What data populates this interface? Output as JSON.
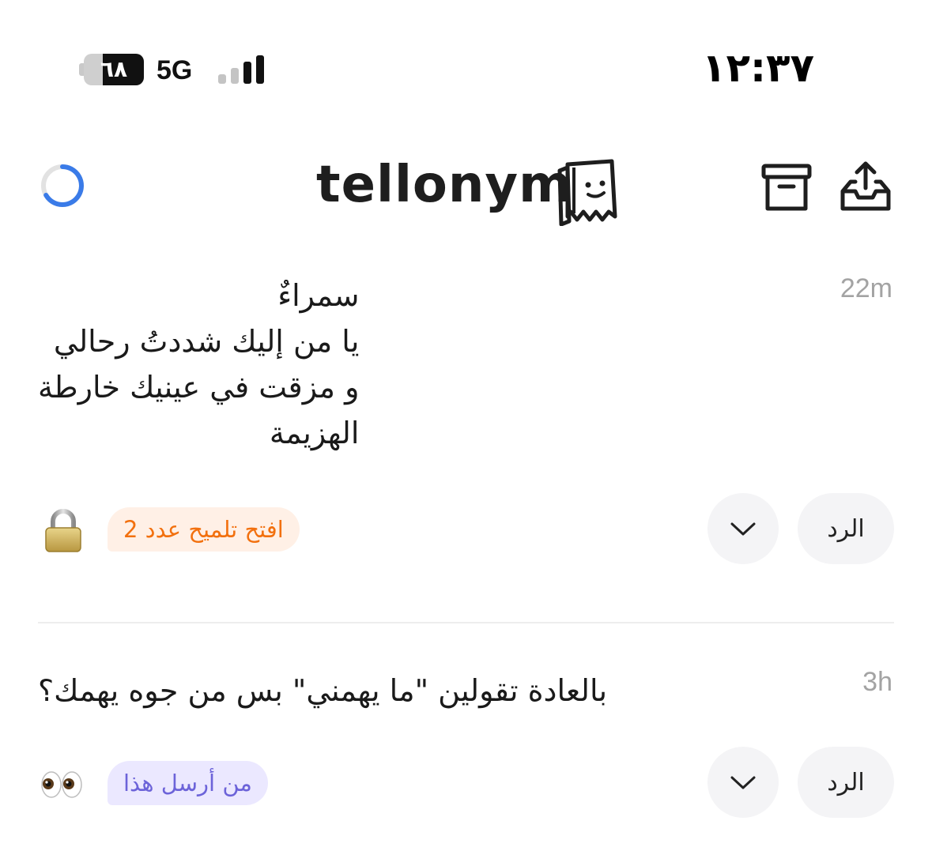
{
  "status_bar": {
    "time": "١٢:٣٧",
    "network": "5G",
    "battery_level": "٦٨",
    "battery_fraction": 0.68,
    "signal_bars": 2,
    "signal_total": 4
  },
  "header": {
    "logo": "tellonym",
    "icons": {
      "left": "loading-ring",
      "archive": "archive-box-icon",
      "share": "inbox-upload-icon"
    }
  },
  "messages": [
    {
      "time": "22m",
      "text": "سمراءٌ\nيا من إليك شددتُ رحالي\nو مزقت في عينيك خارطة\nالهزيمة",
      "reply_label": "الرد",
      "pill_label": "افتح تلميح عدد 2",
      "emoji": "lock-icon"
    },
    {
      "time": "3h",
      "text": "بالعادة تقولين \"ما يهمني\" بس من جوه يهمك؟",
      "reply_label": "الرد",
      "pill_label": "من أرسل هذا",
      "emoji": "eyes-icon"
    }
  ],
  "colors": {
    "accent_blue": "#3a7be8",
    "hint_orange": "#f2700e",
    "hint_bg": "#fff0e6",
    "sender_purple": "#6c63d9",
    "sender_bg": "#ebe8ff",
    "button_bg": "#f4f4f6",
    "time_gray": "#a3a3a3"
  }
}
